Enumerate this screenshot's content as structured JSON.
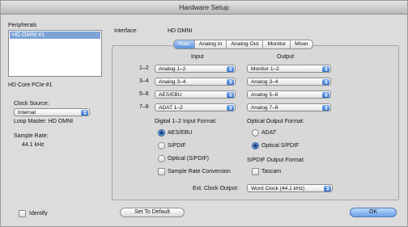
{
  "window": {
    "title": "Hardware Setup"
  },
  "left": {
    "peripherals_label": "Peripherals",
    "peripherals": [
      "HD OMNI #1"
    ],
    "device_label": "HD Core PCIe #1",
    "clock_source_label": "Clock Source:",
    "clock_source_value": "Internal",
    "loop_master": "Loop Master: HD OMNI",
    "sample_rate_label": "Sample Rate:",
    "sample_rate_value": "44.1 kHz",
    "identify_label": "Identify"
  },
  "interface": {
    "label": "Interface:",
    "value": "HD OMNI"
  },
  "tabs": [
    "Main",
    "Analog In",
    "Analog Out",
    "Monitor",
    "Mixer"
  ],
  "selected_tab": "Main",
  "io": {
    "input_header": "Input",
    "output_header": "Output",
    "rows": [
      {
        "channels": "1–2",
        "input": "Analog 1–2",
        "output": "Monitor 1–2"
      },
      {
        "channels": "3–4",
        "input": "Analog 3–4",
        "output": "Analog 3–4"
      },
      {
        "channels": "5–6",
        "input": "AES/EBU",
        "output": "Analog 5–6"
      },
      {
        "channels": "7–8",
        "input": "ADAT 1–2",
        "output": "Analog 7–8"
      }
    ]
  },
  "digital_input": {
    "label": "Digital 1–2 Input Format:",
    "options": [
      {
        "label": "AES/EBU",
        "selected": true
      },
      {
        "label": "S/PDIF",
        "selected": false
      },
      {
        "label": "Optical (S/PDIF)",
        "selected": false
      }
    ],
    "sample_rate_conversion": "Sample Rate Conversion"
  },
  "optical_output": {
    "label": "Optical Output Format:",
    "options": [
      {
        "label": "ADAT",
        "selected": false
      },
      {
        "label": "Optical S/PDIF",
        "selected": true
      }
    ]
  },
  "spdif_output": {
    "label": "S/PDIF Output Format:",
    "tascam": "Tascam"
  },
  "ext_clock": {
    "label": "Ext. Clock Output:",
    "value": "Word Clock (44.1 kHz)"
  },
  "buttons": {
    "set_default": "Set To Default",
    "ok": "OK"
  }
}
